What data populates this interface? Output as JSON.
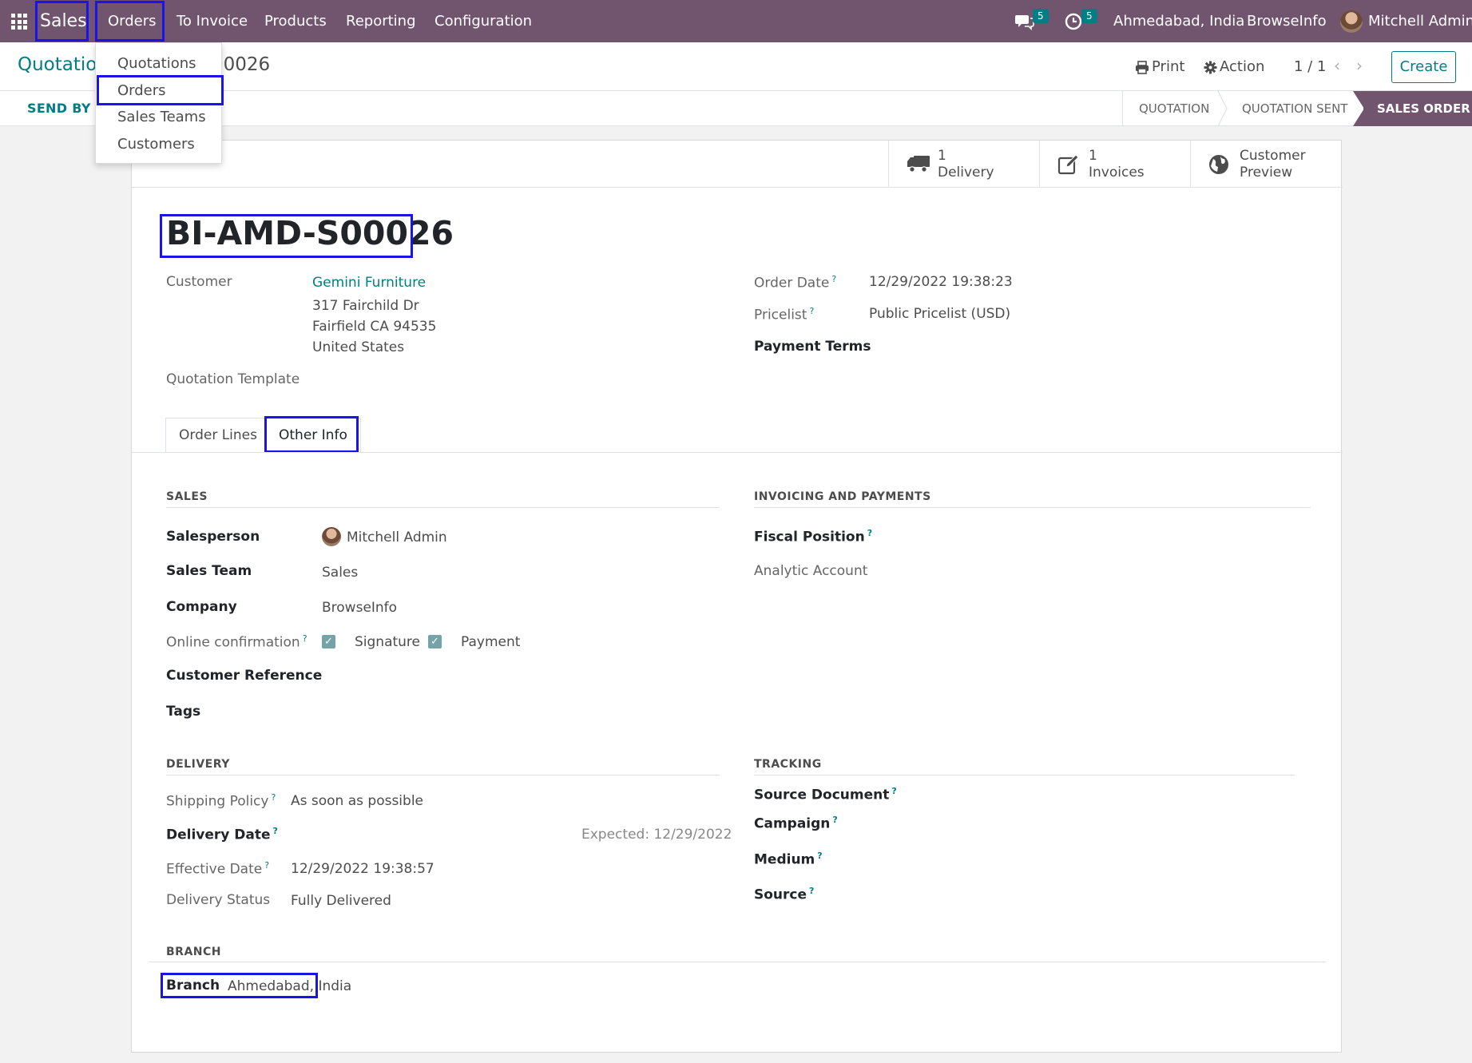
{
  "navbar": {
    "app_name": "Sales",
    "menu": [
      "Orders",
      "To Invoice",
      "Products",
      "Reporting",
      "Configuration"
    ],
    "messages_count": "5",
    "activities_count": "5",
    "branch": "Ahmedabad, India",
    "company": "BrowseInfo",
    "user": "Mitchell Admin"
  },
  "dropdown": {
    "items": [
      "Quotations",
      "Orders",
      "Sales Teams",
      "Customers"
    ]
  },
  "control_panel": {
    "breadcrumb_parent": "Quotatio",
    "breadcrumb_tail": "00026",
    "print": "Print",
    "action": "Action",
    "pager": "1 / 1",
    "create": "Create",
    "send_by_email": "SEND BY E",
    "statuses": [
      "QUOTATION",
      "QUOTATION SENT",
      "SALES ORDER"
    ],
    "active_status": "SALES ORDER"
  },
  "smart_buttons": [
    {
      "icon": "truck-icon",
      "count": "1",
      "label": "Delivery"
    },
    {
      "icon": "edit-icon",
      "count": "1",
      "label": "Invoices"
    },
    {
      "icon": "globe-icon",
      "count": "Customer",
      "label": "Preview"
    }
  ],
  "order": {
    "name": "BI-AMD-S00026",
    "customer_label": "Customer",
    "customer_name": "Gemini Furniture",
    "address": [
      "317 Fairchild Dr",
      "Fairfield CA 94535",
      "United States"
    ],
    "quotation_template_label": "Quotation Template",
    "order_date_label": "Order Date",
    "order_date": "12/29/2022 19:38:23",
    "pricelist_label": "Pricelist",
    "pricelist": "Public Pricelist (USD)",
    "payment_terms_label": "Payment Terms"
  },
  "tabs": [
    "Order Lines",
    "Other Info"
  ],
  "active_tab": "Other Info",
  "sales": {
    "title": "SALES",
    "salesperson_label": "Salesperson",
    "salesperson": "Mitchell Admin",
    "sales_team_label": "Sales Team",
    "sales_team": "Sales",
    "company_label": "Company",
    "company": "BrowseInfo",
    "online_confirmation_label": "Online confirmation",
    "signature_label": "Signature",
    "signature_checked": true,
    "payment_label": "Payment",
    "payment_checked": true,
    "customer_reference_label": "Customer Reference",
    "tags_label": "Tags"
  },
  "invoicing": {
    "title": "INVOICING AND PAYMENTS",
    "fiscal_position_label": "Fiscal Position",
    "analytic_account_label": "Analytic Account"
  },
  "delivery": {
    "title": "DELIVERY",
    "shipping_policy_label": "Shipping Policy",
    "shipping_policy": "As soon as possible",
    "delivery_date_label": "Delivery Date",
    "expected": "Expected: 12/29/2022",
    "effective_date_label": "Effective Date",
    "effective_date": "12/29/2022 19:38:57",
    "delivery_status_label": "Delivery Status",
    "delivery_status": "Fully Delivered"
  },
  "tracking": {
    "title": "TRACKING",
    "source_document_label": "Source Document",
    "campaign_label": "Campaign",
    "medium_label": "Medium",
    "source_label": "Source"
  },
  "branch": {
    "title": "BRANCH",
    "label": "Branch",
    "value": "Ahmedabad, India"
  },
  "colors": {
    "navbar": "#71546d",
    "accent": "#017e84",
    "highlight": "#1a14e6"
  }
}
